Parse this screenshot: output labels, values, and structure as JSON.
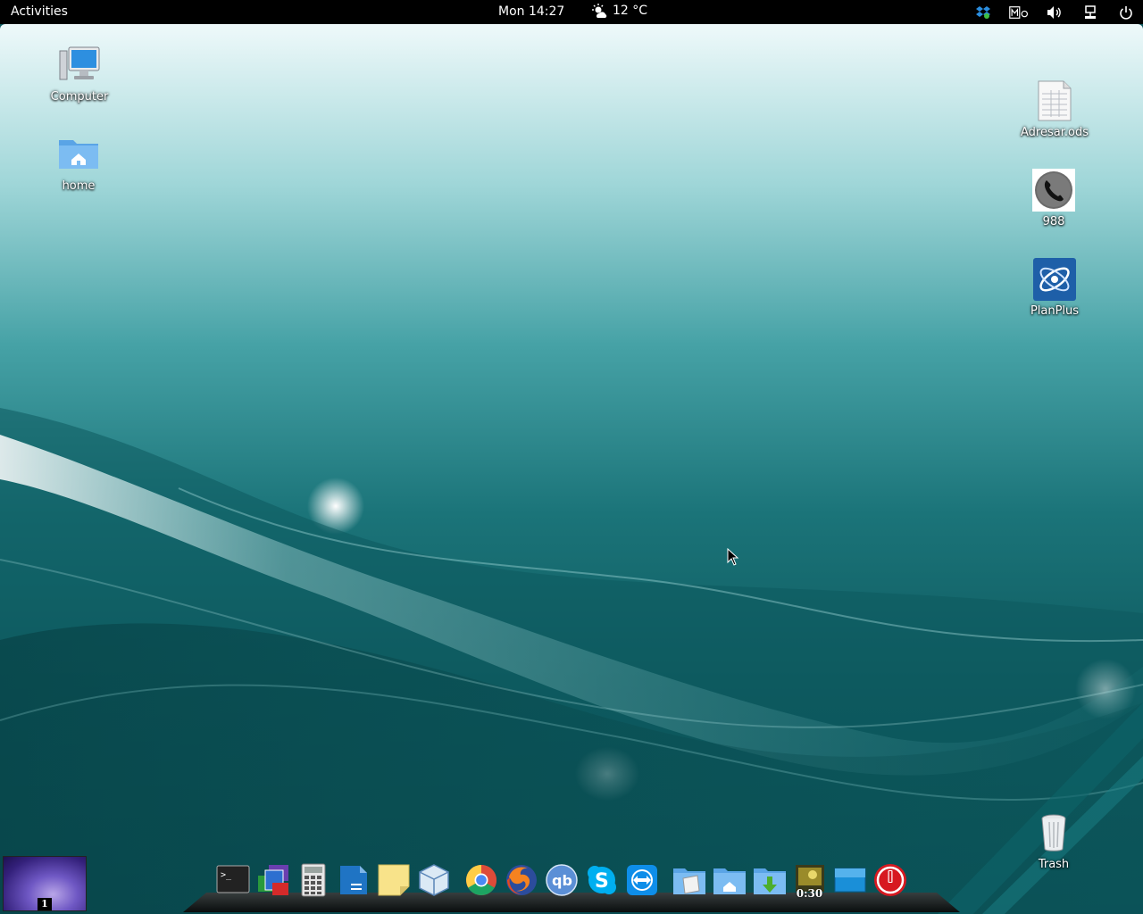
{
  "topbar": {
    "activities": "Activities",
    "clock": "Mon 14:27",
    "weather": {
      "icon": "sun-cloud-icon",
      "temperature": "12 °C"
    },
    "tray": [
      {
        "name": "dropbox-icon"
      },
      {
        "name": "input-method-icon"
      },
      {
        "name": "volume-icon"
      },
      {
        "name": "network-wired-icon"
      },
      {
        "name": "power-icon"
      }
    ]
  },
  "desktop_icons": [
    {
      "label": "Computer",
      "icon": "computer-icon"
    },
    {
      "label": "home",
      "icon": "home-folder-icon"
    },
    {
      "label": "Adresar.ods",
      "icon": "spreadsheet-file-icon"
    },
    {
      "label": "988",
      "icon": "phone-icon"
    },
    {
      "label": "PlanPlus",
      "icon": "planplus-icon"
    },
    {
      "label": "Trash",
      "icon": "trash-icon"
    }
  ],
  "workspace": {
    "number": "1"
  },
  "dock": [
    {
      "name": "terminal-icon"
    },
    {
      "name": "image-viewer-icon"
    },
    {
      "name": "calculator-icon"
    },
    {
      "name": "libreoffice-writer-icon"
    },
    {
      "name": "sticky-notes-icon"
    },
    {
      "name": "virtualbox-icon"
    },
    {
      "name": "chrome-icon"
    },
    {
      "name": "firefox-icon"
    },
    {
      "name": "qbittorrent-icon"
    },
    {
      "name": "skype-icon"
    },
    {
      "name": "teamviewer-icon"
    },
    {
      "name": "documents-folder-icon"
    },
    {
      "name": "home-folder-icon"
    },
    {
      "name": "downloads-folder-icon"
    },
    {
      "name": "video-player-icon",
      "badge": "0:30"
    },
    {
      "name": "show-desktop-icon"
    },
    {
      "name": "shutdown-icon"
    }
  ],
  "colors": {
    "topbar_bg": "#000000",
    "desktop_teal": "#1b7479",
    "workspace_purple": "#6f58c4"
  }
}
